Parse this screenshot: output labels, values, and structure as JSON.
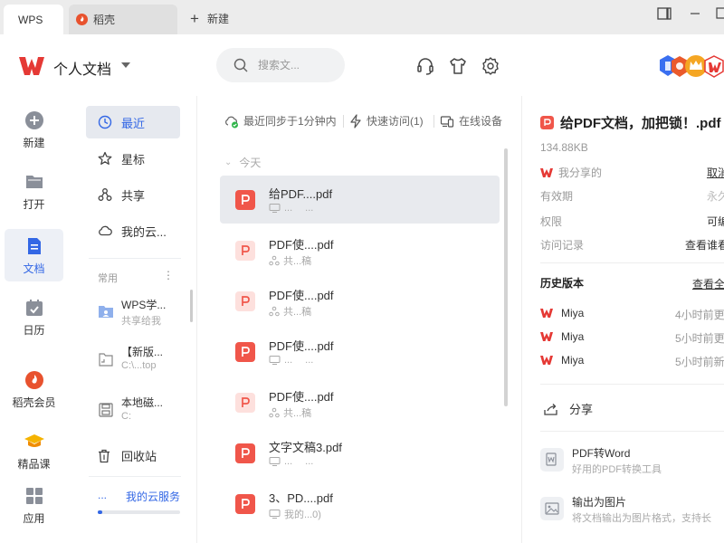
{
  "titlebar": {
    "tabs": [
      {
        "label": "WPS"
      },
      {
        "label": "稻壳"
      }
    ],
    "new_tab_label": "新建"
  },
  "header": {
    "title": "个人文档",
    "search_placeholder": "搜索文..."
  },
  "leftnav": {
    "items": [
      {
        "label": "新建",
        "icon": "plus-circle-icon"
      },
      {
        "label": "打开",
        "icon": "folder-icon"
      },
      {
        "label": "文档",
        "icon": "document-icon",
        "active": true
      },
      {
        "label": "日历",
        "icon": "calendar-icon"
      },
      {
        "label": "稻壳会员",
        "icon": "daoke-flame-icon"
      },
      {
        "label": "精品课",
        "icon": "graduation-cap-icon"
      },
      {
        "label": "应用",
        "icon": "apps-grid-icon"
      }
    ]
  },
  "sidebar": {
    "items": [
      {
        "label": "最近",
        "icon": "clock-icon",
        "active": true
      },
      {
        "label": "星标",
        "icon": "star-icon"
      },
      {
        "label": "共享",
        "icon": "share-icon"
      },
      {
        "label": "我的云...",
        "icon": "cloud-icon"
      }
    ],
    "group_label": "常用",
    "group_more": "⋮",
    "favorites": [
      {
        "title": "WPS学...",
        "subtitle": "共享给我",
        "icon": "shared-folder-icon"
      },
      {
        "title": "【新版...",
        "subtitle": "C:\\...top",
        "icon": "local-folder-icon"
      },
      {
        "title": "本地磁...",
        "subtitle": "C:",
        "icon": "disk-icon"
      }
    ],
    "trash_label": "回收站",
    "cloud_dots": "...",
    "cloud_link": "我的云服务",
    "cloud_usage_percent": 5
  },
  "filelist": {
    "sync": {
      "synced": "最近同步于1分钟内",
      "quick_access": "快速访问(1)",
      "online_devices": "在线设备"
    },
    "group_today": "今天",
    "files": [
      {
        "name": "给PDF....pdf",
        "meta1": "...",
        "meta2": "...",
        "meta_icon": "computer-icon",
        "variant": "solid",
        "selected": true
      },
      {
        "name": "PDF使....pdf",
        "meta1": "共...稿",
        "meta2": "",
        "meta_icon": "share-icon",
        "variant": "light"
      },
      {
        "name": "PDF使....pdf",
        "meta1": "共...稿",
        "meta2": "",
        "meta_icon": "share-icon",
        "variant": "light"
      },
      {
        "name": "PDF使....pdf",
        "meta1": "...",
        "meta2": "...",
        "meta_icon": "computer-icon",
        "variant": "solid"
      },
      {
        "name": "PDF使....pdf",
        "meta1": "共...稿",
        "meta2": "",
        "meta_icon": "share-icon",
        "variant": "light"
      },
      {
        "name": "文字文稿3.pdf",
        "meta1": "...",
        "meta2": "...",
        "meta_icon": "computer-icon",
        "variant": "solid"
      },
      {
        "name": "3、PD....pdf",
        "meta1": "我的...0)",
        "meta2": "",
        "meta_icon": "computer-icon",
        "variant": "solid"
      }
    ]
  },
  "detail": {
    "title": "给PDF文档，加把锁！.pdf",
    "size": "134.88KB",
    "info": [
      {
        "key": "我分享的",
        "value": "取消分",
        "style": "u",
        "icon": "wps-logo-icon"
      },
      {
        "key": "有效期",
        "value": "永久有",
        "style": "muted"
      },
      {
        "key": "权限",
        "value": "可编辑",
        "style": ""
      },
      {
        "key": "访问记录",
        "value": "查看谁看过",
        "style": ""
      }
    ],
    "history_title": "历史版本",
    "history_link": "查看全",
    "history": [
      {
        "user": "Miya",
        "time": "4小时前更"
      },
      {
        "user": "Miya",
        "time": "5小时前更"
      },
      {
        "user": "Miya",
        "time": "5小时前新"
      }
    ],
    "share_label": "分享",
    "tools": [
      {
        "title": "PDF转Word",
        "desc": "好用的PDF转换工具",
        "icon": "pdf-to-word-icon"
      },
      {
        "title": "输出为图片",
        "desc": "将文档输出为图片格式，支持长",
        "icon": "export-image-icon"
      }
    ]
  },
  "colors": {
    "accent": "#3367e5",
    "wps_red": "#e53935",
    "pdf_red": "#f0564a",
    "pdf_light": "#fde0dd",
    "nav_active_bg": "#edf0f6"
  }
}
